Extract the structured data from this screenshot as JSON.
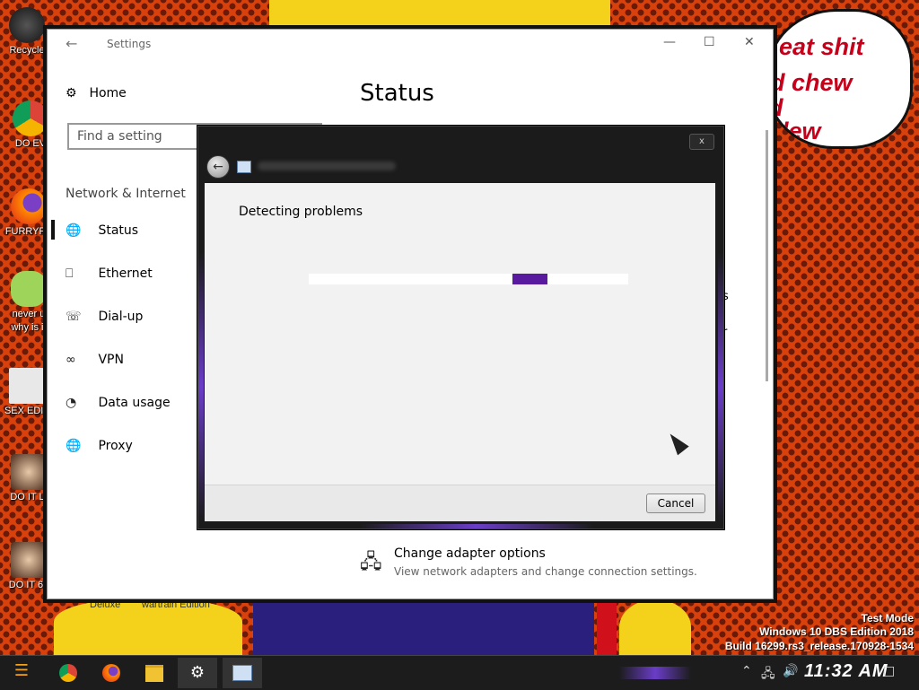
{
  "wallpaper": {
    "speech_lines": [
      "eat shit",
      "d chew",
      "d",
      "dew"
    ],
    "desktop_icons": [
      "Recycle",
      "DO EV",
      "FURRYFU",
      "never u",
      "why is it",
      "SEX EDIT",
      "DO IT LI",
      "DO IT 64"
    ],
    "bottom_labels": [
      "Deluxe",
      "wartrain Edition"
    ],
    "watermark": [
      "Test Mode",
      "Windows 10 DBS Edition 2018",
      "Build 16299.rs3_release.170928-1534"
    ]
  },
  "settings": {
    "window_title": "Settings",
    "home_label": "Home",
    "search_placeholder": "Find a setting",
    "section_title": "Network & Internet",
    "nav_items": [
      {
        "label": "Status",
        "icon": "globe-status-icon"
      },
      {
        "label": "Ethernet",
        "icon": "ethernet-icon"
      },
      {
        "label": "Dial-up",
        "icon": "dialup-icon"
      },
      {
        "label": "VPN",
        "icon": "vpn-icon"
      },
      {
        "label": "Data usage",
        "icon": "data-usage-icon"
      },
      {
        "label": "Proxy",
        "icon": "globe-icon"
      }
    ],
    "selected_item": "Status",
    "page_title": "Status",
    "adapter_title": "Change adapter options",
    "adapter_desc": "View network adapters and change connection settings.",
    "fragment_1": "s",
    "fragment_2": "r"
  },
  "dialog": {
    "heading": "Detecting problems",
    "cancel_label": "Cancel",
    "close_glyph": "x",
    "progress_indeterminate": true,
    "accent_color": "#5a1aa0"
  },
  "taskbar": {
    "clock": "11:32 AM",
    "apps": [
      "start-icon",
      "chrome-icon",
      "firefox-icon",
      "file-explorer-icon",
      "settings-icon",
      "troubleshooter-icon"
    ]
  }
}
